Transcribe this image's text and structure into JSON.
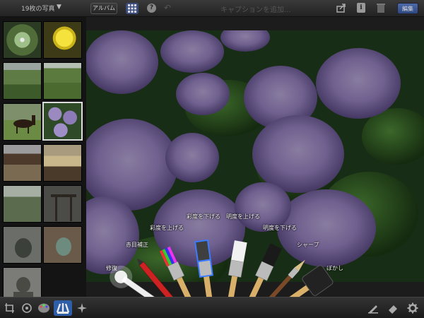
{
  "topbar": {
    "photo_count": "19枚の写真",
    "count_caret": "▼",
    "album_button": "アルバム",
    "help_label": "?",
    "undo_label": "↶",
    "caption_placeholder": "キャプションを追加...",
    "info_label": "i",
    "edit_button": "編集"
  },
  "thumbnails": [
    "plant",
    "yellow-flower",
    "garden",
    "bushes",
    "horse",
    "hydrangea",
    "temple-roof",
    "straw-rope",
    "garden-tree",
    "torii-gate",
    "statue",
    "stone-monument",
    "buddha-statue"
  ],
  "brushes": [
    {
      "key": "repair",
      "label": "修復"
    },
    {
      "key": "red-eye",
      "label": "赤目補正"
    },
    {
      "key": "saturate",
      "label": "彩度を上げる"
    },
    {
      "key": "desaturate",
      "label": "彩度を下げる"
    },
    {
      "key": "lighten",
      "label": "明度を上げる"
    },
    {
      "key": "darken",
      "label": "明度を下げる"
    },
    {
      "key": "sharpen",
      "label": "シャープ"
    },
    {
      "key": "soften",
      "label": "ぼかし"
    }
  ],
  "colors": {
    "accent": "#3b5998",
    "selected_brush_glow": "#3a7bff"
  },
  "bottombar": {
    "icons": [
      "crop-icon",
      "enhance-icon",
      "palette-icon",
      "brushes-icon",
      "effects-icon",
      "pen-icon",
      "eraser-icon",
      "gear-icon"
    ]
  }
}
